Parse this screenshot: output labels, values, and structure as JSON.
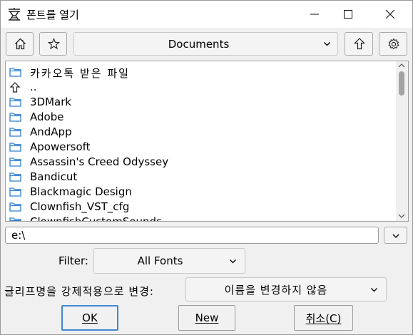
{
  "window": {
    "title": "폰트를 열기",
    "app_icon": "kakao-typewriter-icon"
  },
  "toolbar": {
    "home_icon": "home-icon",
    "favorites_icon": "star-icon",
    "directory": "Documents",
    "up_icon": "arrow-up-icon",
    "settings_icon": "gear-icon"
  },
  "files": [
    {
      "name": "카카오톡 받은 파일",
      "icon": "folder-icon"
    },
    {
      "name": "..",
      "icon": "arrow-up-icon"
    },
    {
      "name": "3DMark",
      "icon": "folder-icon"
    },
    {
      "name": "Adobe",
      "icon": "folder-icon"
    },
    {
      "name": "AndApp",
      "icon": "folder-icon"
    },
    {
      "name": "Apowersoft",
      "icon": "folder-icon"
    },
    {
      "name": "Assassin's Creed Odyssey",
      "icon": "folder-icon"
    },
    {
      "name": "Bandicut",
      "icon": "folder-icon"
    },
    {
      "name": "Blackmagic Design",
      "icon": "folder-icon"
    },
    {
      "name": "Clownfish_VST_cfg",
      "icon": "folder-icon"
    },
    {
      "name": "ClownfishCustomSounds",
      "icon": "folder-icon"
    }
  ],
  "path": {
    "value": "e:\\"
  },
  "filter": {
    "label": "Filter:",
    "value": "All Fonts"
  },
  "rename": {
    "label": "글리프명을 강제적용으로 변경:",
    "value": "이름을 변경하지 않음"
  },
  "buttons": {
    "ok": "OK",
    "new": "New",
    "cancel": "취소(C)"
  },
  "colors": {
    "folder": "#2f7fd1",
    "focus": "#3d88d6"
  }
}
